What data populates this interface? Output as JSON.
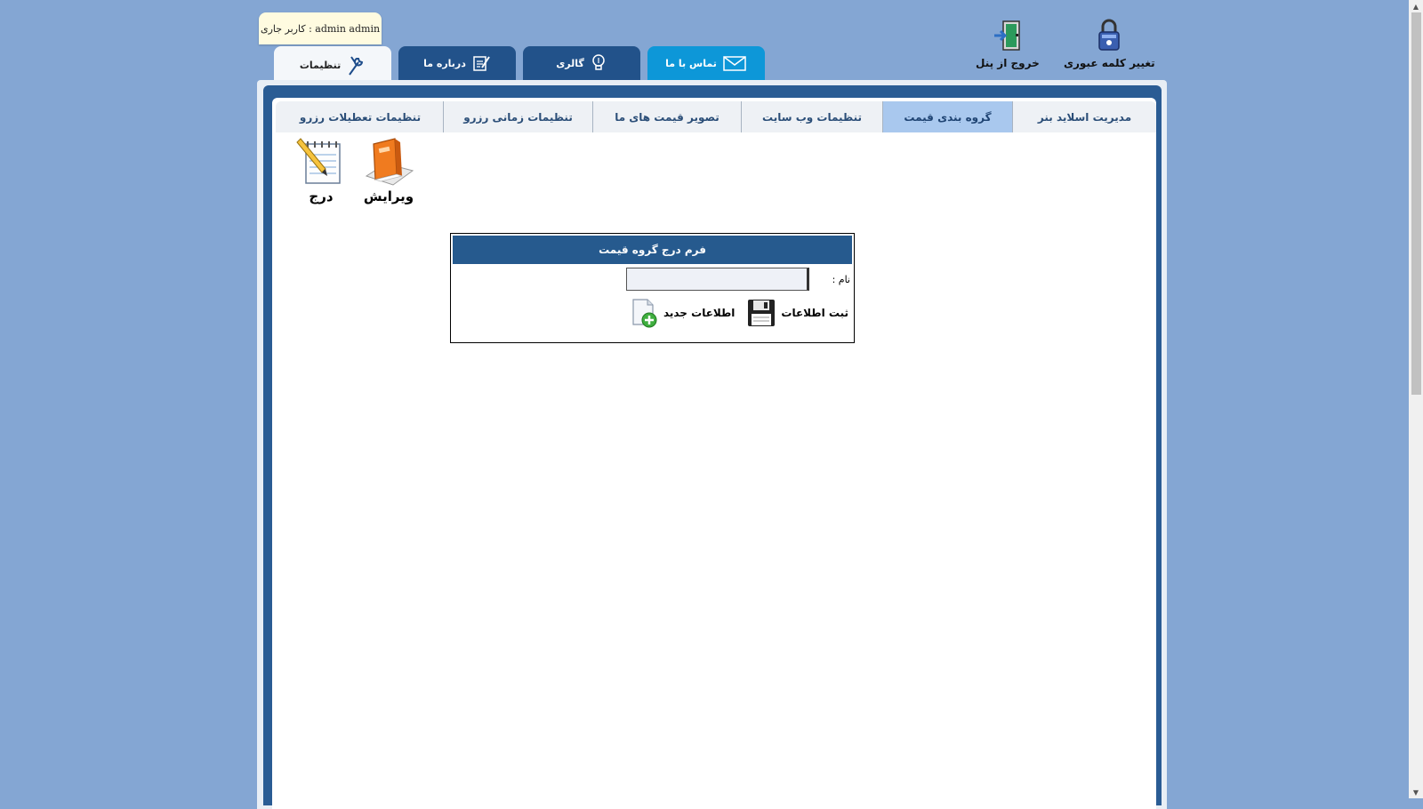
{
  "top_actions": {
    "change_password": {
      "label": "تغییر کلمه عبوری",
      "icon": "padlock-icon"
    },
    "logout": {
      "label": "خروج از پنل",
      "icon": "exit-door-icon"
    }
  },
  "user_badge": {
    "text": "admin admin : کاربر جاری"
  },
  "main_tabs": [
    {
      "label": "تنظیمات",
      "icon": "wrench-icon",
      "active": true
    },
    {
      "label": "درباره ما",
      "icon": "edit-note-icon"
    },
    {
      "label": "گالری",
      "icon": "lightbulb-icon"
    },
    {
      "label": "تماس با ما",
      "icon": "envelope-icon"
    }
  ],
  "sub_tabs": [
    {
      "label": "مدیریت اسلاید بنر"
    },
    {
      "label": "گروه بندی قیمت",
      "active": true
    },
    {
      "label": "تنظیمات وب سایت"
    },
    {
      "label": "تصویر قیمت های ما"
    },
    {
      "label": "تنظیمات زمانی رزرو"
    },
    {
      "label": "تنظیمات تعطیلات رزرو"
    }
  ],
  "actions": {
    "edit": {
      "label": "ویرایش",
      "icon": "book-icon"
    },
    "insert": {
      "label": "درج",
      "icon": "notepad-pencil-icon"
    }
  },
  "form": {
    "title": "فرم درج گروه قیمت",
    "name_label": "نام :",
    "name_value": "",
    "submit_label": "ثبت اطلاعات",
    "new_label": "اطلاعات جدید"
  },
  "colors": {
    "background": "#84a6d3",
    "tab_dark": "#22528a",
    "tab_light": "#0d97d8",
    "form_header": "#265a8e",
    "subtab_active": "#a9c8ee"
  }
}
